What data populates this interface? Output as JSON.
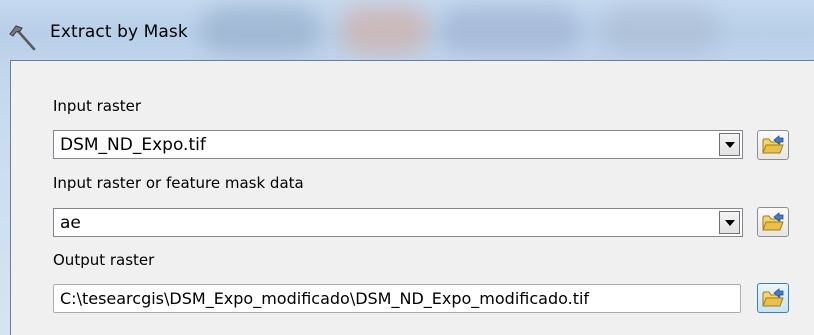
{
  "window": {
    "title": "Extract by Mask",
    "icon": "hammer-icon"
  },
  "fields": {
    "input_raster": {
      "label": "Input raster",
      "value": "DSM_ND_Expo.tif",
      "browse_icon": "open-folder-icon"
    },
    "mask_data": {
      "label": "Input raster or feature mask data",
      "value": "ae",
      "browse_icon": "open-folder-icon"
    },
    "output_raster": {
      "label": "Output raster",
      "value": "C:\\tesearcgis\\DSM_Expo_modificado\\DSM_ND_Expo_modificado.tif",
      "browse_icon": "open-folder-icon"
    }
  },
  "colors": {
    "titlebar": "#b8cfe8",
    "panel": "#f0f0f0",
    "folder": "#e8c04a"
  }
}
